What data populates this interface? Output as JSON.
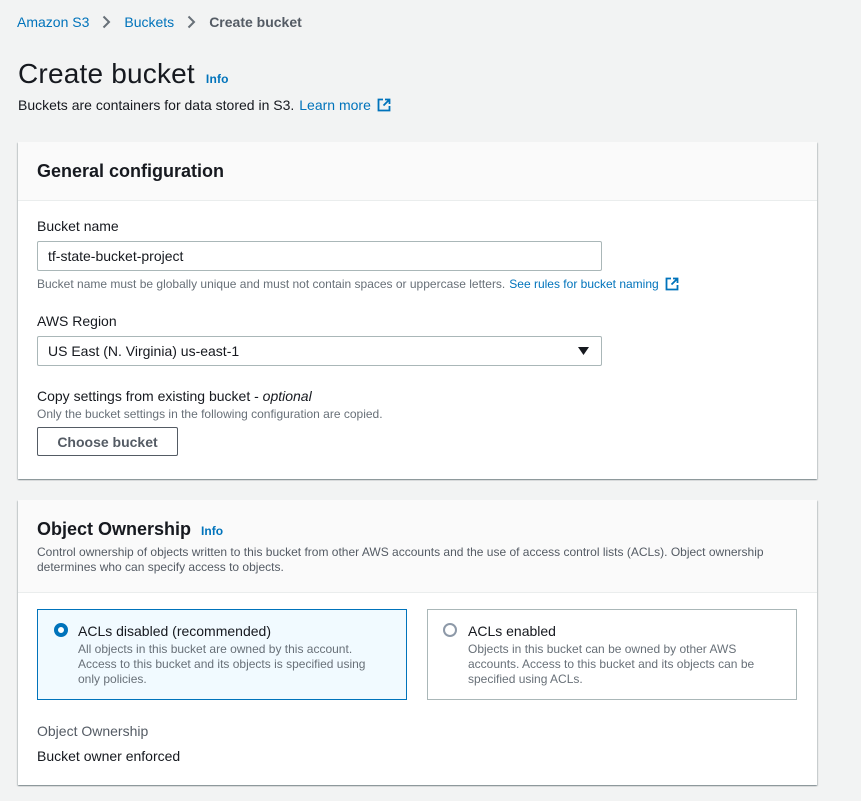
{
  "breadcrumb": {
    "items": [
      "Amazon S3",
      "Buckets"
    ],
    "current": "Create bucket"
  },
  "header": {
    "title": "Create bucket",
    "info": "Info",
    "description": "Buckets are containers for data stored in S3.",
    "learn_more": "Learn more"
  },
  "general": {
    "title": "General configuration",
    "bucket_name_label": "Bucket name",
    "bucket_name_value": "tf-state-bucket-project",
    "bucket_name_hint": "Bucket name must be globally unique and must not contain spaces or uppercase letters.",
    "bucket_name_rules_link": "See rules for bucket naming",
    "region_label": "AWS Region",
    "region_value": "US East (N. Virginia) us-east-1",
    "copy_label": "Copy settings from existing bucket - ",
    "copy_optional": "optional",
    "copy_hint": "Only the bucket settings in the following configuration are copied.",
    "choose_button": "Choose bucket"
  },
  "ownership": {
    "title": "Object Ownership",
    "info": "Info",
    "description_line1": "Control ownership of objects written to this bucket from other AWS accounts and the use of access control lists (ACLs). Object ownership",
    "description_line2": "determines who can specify access to objects.",
    "options": [
      {
        "title": "ACLs disabled (recommended)",
        "desc1": "All objects in this bucket are owned by this account.",
        "desc2": "Access to this bucket and its objects is specified using",
        "desc3": "only policies.",
        "selected": true
      },
      {
        "title": "ACLs enabled",
        "desc1": "Objects in this bucket can be owned by other AWS",
        "desc2": "accounts. Access to this bucket and its objects can be",
        "desc3": "specified using ACLs.",
        "selected": false
      }
    ],
    "result_label": "Object Ownership",
    "result_value": "Bucket owner enforced"
  },
  "colors": {
    "link": "#0073bb",
    "background": "#f2f3f3",
    "text": "#16191f",
    "muted": "#687078"
  }
}
